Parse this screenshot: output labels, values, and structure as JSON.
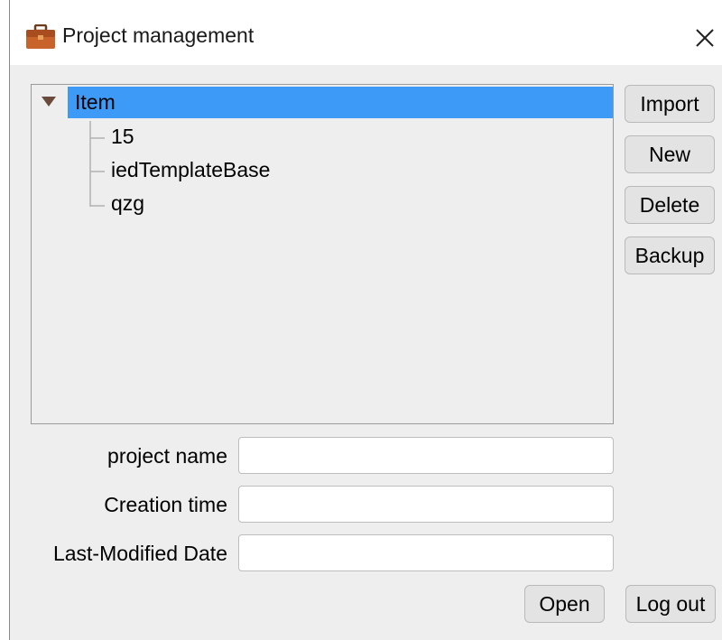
{
  "window": {
    "title": "Project management",
    "title_icon": "briefcase-icon",
    "close_icon": "close-icon"
  },
  "tree": {
    "root": {
      "label": "Item",
      "expanded": true,
      "selected": true
    },
    "children": [
      {
        "label": "15"
      },
      {
        "label": "iedTemplateBase"
      },
      {
        "label": "qzg"
      }
    ]
  },
  "side_buttons": {
    "import": "Import",
    "new": "New",
    "delete": "Delete",
    "backup": "Backup"
  },
  "fields": {
    "project_name": {
      "label": "project name",
      "value": ""
    },
    "creation_time": {
      "label": "Creation time",
      "value": ""
    },
    "last_modified": {
      "label": "Last-Modified Date",
      "value": ""
    }
  },
  "bottom_buttons": {
    "open": "Open",
    "logout": "Log out"
  },
  "colors": {
    "selection": "#3d9bf7",
    "panel_bg": "#eeeeee",
    "icon_orange": "#c0602a"
  }
}
